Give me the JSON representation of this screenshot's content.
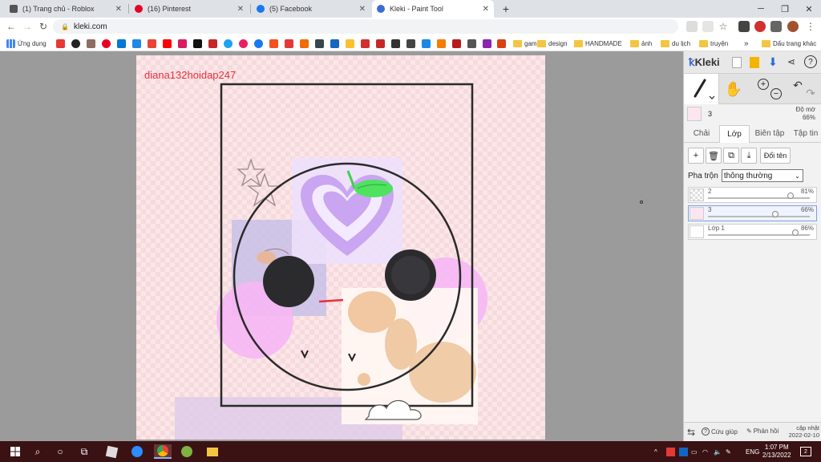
{
  "tabs": [
    {
      "title": "(1) Trang chủ - Roblox",
      "icon": "roblox-icon",
      "color": "#555555"
    },
    {
      "title": "(16) Pinterest",
      "icon": "pinterest-icon",
      "color": "#e60023"
    },
    {
      "title": "(5) Facebook",
      "icon": "facebook-icon",
      "color": "#1877f2"
    },
    {
      "title": "Kleki - Paint Tool",
      "icon": "kleki-icon",
      "color": "#3b6bd6"
    }
  ],
  "tab_close": "✕",
  "new_tab": "+",
  "window": {
    "minimize": "─",
    "restore": "❐",
    "close": "✕"
  },
  "address": {
    "url": "kleki.com"
  },
  "bookmarks": {
    "apps_label": "Ứng dụng",
    "folders": [
      "game",
      "design",
      "HANDMADE",
      "ảnh",
      "du lịch",
      "truyện"
    ],
    "overflow": "»",
    "other": "Dấu trang khác"
  },
  "canvas": {
    "watermark": "diana132hoidap247"
  },
  "panel": {
    "logo": "Kleki",
    "current_layer_name": "3",
    "opacity_label": "Độ mờ",
    "opacity_value": "66%",
    "tabs": [
      "Chải",
      "Lớp",
      "Biên tập",
      "Tập tin"
    ],
    "active_tab": 1,
    "rename_label": "Đổi tên",
    "blend_label": "Pha trộn",
    "blend_value": "thông thường",
    "layers": [
      {
        "name": "2",
        "opacity": "81%",
        "level": 0.81,
        "selected": false
      },
      {
        "name": "3",
        "opacity": "66%",
        "level": 0.66,
        "selected": true
      },
      {
        "name": "Lớp 1",
        "opacity": "86%",
        "level": 0.86,
        "selected": false
      }
    ],
    "footer": {
      "help": "Cứu giúp",
      "feedback": "Phản hồi",
      "updated_label": "cập nhật",
      "updated_date": "2022-02-10"
    }
  },
  "taskbar": {
    "time": "1:07 PM",
    "date": "2/13/2022",
    "lang": "ENG",
    "notif_count": "2",
    "caret": "^"
  },
  "colors": {
    "accent": "#3b6bd6",
    "watermark": "#e8303c",
    "taskbar": "#3a1214"
  }
}
